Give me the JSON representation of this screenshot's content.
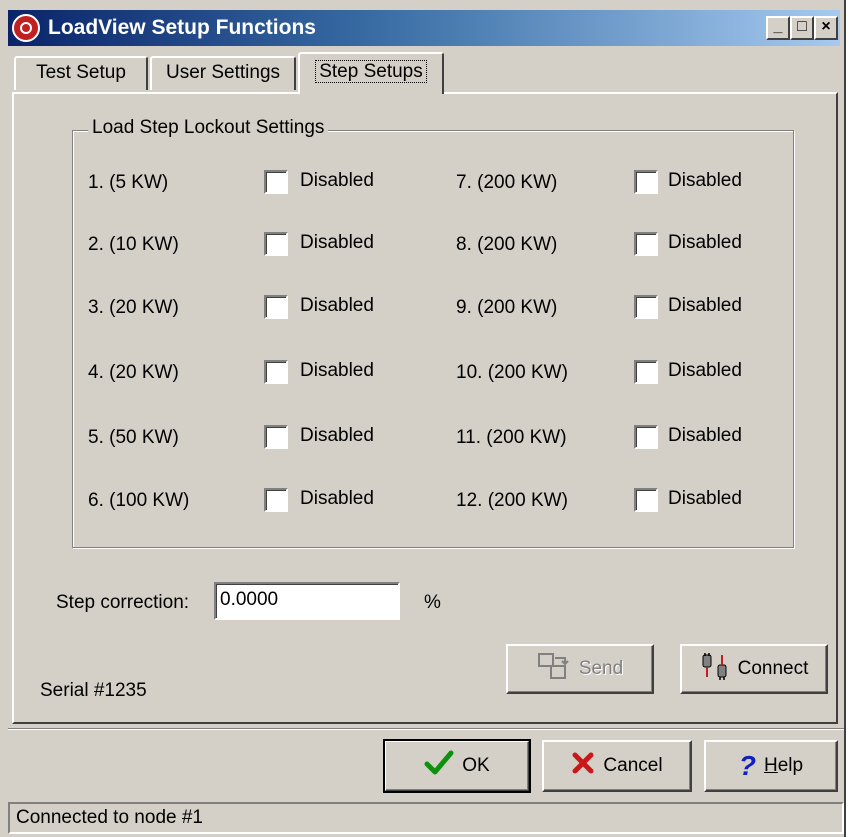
{
  "window": {
    "title": "LoadView Setup Functions",
    "minimize_label": "_",
    "maximize_label": "□",
    "close_label": "×"
  },
  "tabs": [
    {
      "label": "Test Setup"
    },
    {
      "label": "User Settings"
    },
    {
      "label": "Step Setups",
      "active": true
    }
  ],
  "lockout": {
    "group_title": "Load Step Lockout Settings",
    "steps": [
      {
        "label": "1. (5 KW)",
        "checkbox_label": "Disabled",
        "checked": false
      },
      {
        "label": "2. (10 KW)",
        "checkbox_label": "Disabled",
        "checked": false
      },
      {
        "label": "3. (20 KW)",
        "checkbox_label": "Disabled",
        "checked": false
      },
      {
        "label": "4. (20 KW)",
        "checkbox_label": "Disabled",
        "checked": false
      },
      {
        "label": "5. (50 KW)",
        "checkbox_label": "Disabled",
        "checked": false
      },
      {
        "label": "6. (100 KW)",
        "checkbox_label": "Disabled",
        "checked": false
      },
      {
        "label": "7. (200 KW)",
        "checkbox_label": "Disabled",
        "checked": false
      },
      {
        "label": "8. (200 KW)",
        "checkbox_label": "Disabled",
        "checked": false
      },
      {
        "label": "9. (200 KW)",
        "checkbox_label": "Disabled",
        "checked": false
      },
      {
        "label": "10. (200 KW)",
        "checkbox_label": "Disabled",
        "checked": false
      },
      {
        "label": "11. (200 KW)",
        "checkbox_label": "Disabled",
        "checked": false
      },
      {
        "label": "12. (200 KW)",
        "checkbox_label": "Disabled",
        "checked": false
      }
    ]
  },
  "step_correction": {
    "label": "Step correction:",
    "value": "0.0000",
    "unit": "%"
  },
  "serial": "Serial #1235",
  "buttons": {
    "send": "Send",
    "connect": "Connect",
    "ok": "OK",
    "cancel": "Cancel",
    "help_underlined": "H",
    "help_rest": "elp"
  },
  "icons": {
    "send": "send-icon",
    "connect": "connect-icon",
    "ok": "checkmark-icon",
    "cancel": "x-icon",
    "help": "question-mark-icon",
    "app": "app-logo-icon"
  },
  "colors": {
    "title_gradient_start": "#0a246a",
    "title_gradient_end": "#a6caf0",
    "ok_green": "#109010",
    "cancel_red": "#c81818",
    "help_blue": "#1020c0"
  },
  "status": {
    "text": "Connected to node #1"
  }
}
